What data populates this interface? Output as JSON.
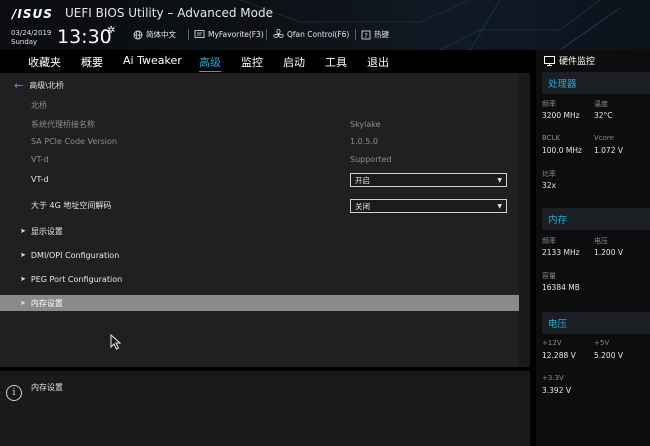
{
  "header": {
    "brand": "/ISUS",
    "app_title": "UEFI BIOS Utility – Advanced Mode",
    "date": "03/24/2019",
    "weekday": "Sunday",
    "time": "13:30",
    "language_label": "简体中文",
    "myfavorite_label": "MyFavorite(F3)",
    "qfan_label": "Qfan Control(F6)",
    "hotkeys_label": "热键"
  },
  "menu": {
    "tabs": [
      {
        "label": "收藏夹"
      },
      {
        "label": "概要"
      },
      {
        "label": "Ai Tweaker"
      },
      {
        "label": "高级"
      },
      {
        "label": "监控"
      },
      {
        "label": "启动"
      },
      {
        "label": "工具"
      },
      {
        "label": "退出"
      }
    ],
    "active": "高级"
  },
  "main": {
    "breadcrumb": "高级\\北桥",
    "section": "北桥",
    "info_rows": [
      {
        "label": "系统代理桥接名称",
        "value": "Skylake"
      },
      {
        "label": "SA PCIe Code Version",
        "value": "1.0.5.0"
      },
      {
        "label": "VT-d",
        "value": "Supported"
      }
    ],
    "settings": [
      {
        "label": "VT-d",
        "value": "开启"
      },
      {
        "label": "大于 4G 地址空间解码",
        "value": "关闭"
      }
    ],
    "submenus": [
      {
        "label": "显示设置"
      },
      {
        "label": "DMI/OPI Configuration"
      },
      {
        "label": "PEG Port Configuration"
      },
      {
        "label": "内存设置"
      }
    ]
  },
  "help": {
    "text": "内存设置"
  },
  "hwmon": {
    "title": "硬件监控",
    "cpu": {
      "title": "处理器",
      "freq_label": "频率",
      "freq": "3200 MHz",
      "temp_label": "温度",
      "temp": "32°C",
      "bclk_label": "BCLK",
      "bclk": "100.0 MHz",
      "vcore_label": "Vcore",
      "vcore": "1.072 V",
      "ratio_label": "比率",
      "ratio": "32x"
    },
    "memory": {
      "title": "内存",
      "freq_label": "频率",
      "freq": "2133 MHz",
      "volt_label": "电压",
      "volt": "1.200 V",
      "cap_label": "容量",
      "cap": "16384 MB"
    },
    "voltage": {
      "title": "电压",
      "v12_label": "+12V",
      "v12": "12.288 V",
      "v5_label": "+5V",
      "v5": "5.200 V",
      "v33_label": "+3.3V",
      "v33": "3.392 V"
    }
  },
  "colors": {
    "accent": "#22a4d8",
    "highlight_row": "#8a8a8a",
    "panel_bg": "#202020"
  },
  "icons": [
    "settings-gear-icon",
    "globe-icon",
    "myfavorite-icon",
    "fan-icon",
    "help-key-icon",
    "back-arrow-icon",
    "chevron-right-icon",
    "info-icon",
    "monitor-icon",
    "mouse-cursor-icon"
  ]
}
